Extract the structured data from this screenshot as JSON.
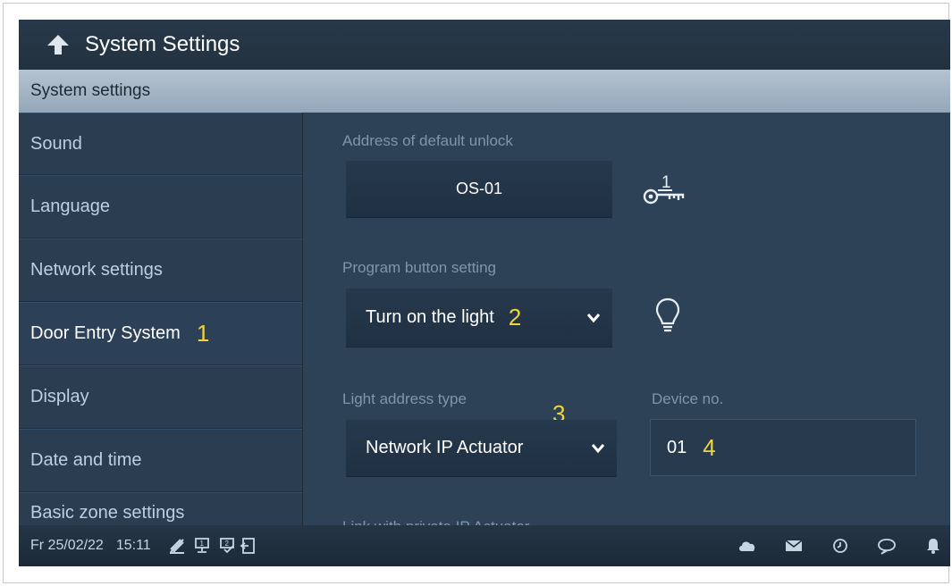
{
  "header": {
    "title": "System Settings"
  },
  "section": {
    "title": "System settings"
  },
  "sidebar": {
    "items": [
      {
        "label": "Sound"
      },
      {
        "label": "Language"
      },
      {
        "label": "Network settings"
      },
      {
        "label": "Door Entry System",
        "marker": "1",
        "active": true
      },
      {
        "label": "Display"
      },
      {
        "label": "Date and time"
      },
      {
        "label": "Basic zone settings"
      }
    ]
  },
  "main": {
    "default_unlock": {
      "label": "Address of default unlock",
      "value": "OS-01",
      "icon_badge": "1"
    },
    "program_button": {
      "label": "Program button setting",
      "value": "Turn on the light",
      "marker": "2"
    },
    "light_address_type": {
      "label": "Light address type",
      "value": "Network IP Actuator",
      "marker": "3"
    },
    "device_no": {
      "label": "Device no.",
      "value": "01",
      "marker": "4"
    },
    "link_private": {
      "label": "Link with private IP Actuator"
    }
  },
  "statusbar": {
    "date": "Fr 25/02/22",
    "time": "15:11",
    "icons_left": [
      "clean-screen-icon",
      "intercom-1-icon",
      "intercom-2-icon",
      "door-exit-icon"
    ],
    "icons_right": [
      "cloud-icon",
      "mail-icon",
      "history-icon",
      "chat-icon",
      "bell-icon"
    ]
  },
  "colors": {
    "accent_marker": "#f0d438",
    "background": "#2e4257"
  }
}
